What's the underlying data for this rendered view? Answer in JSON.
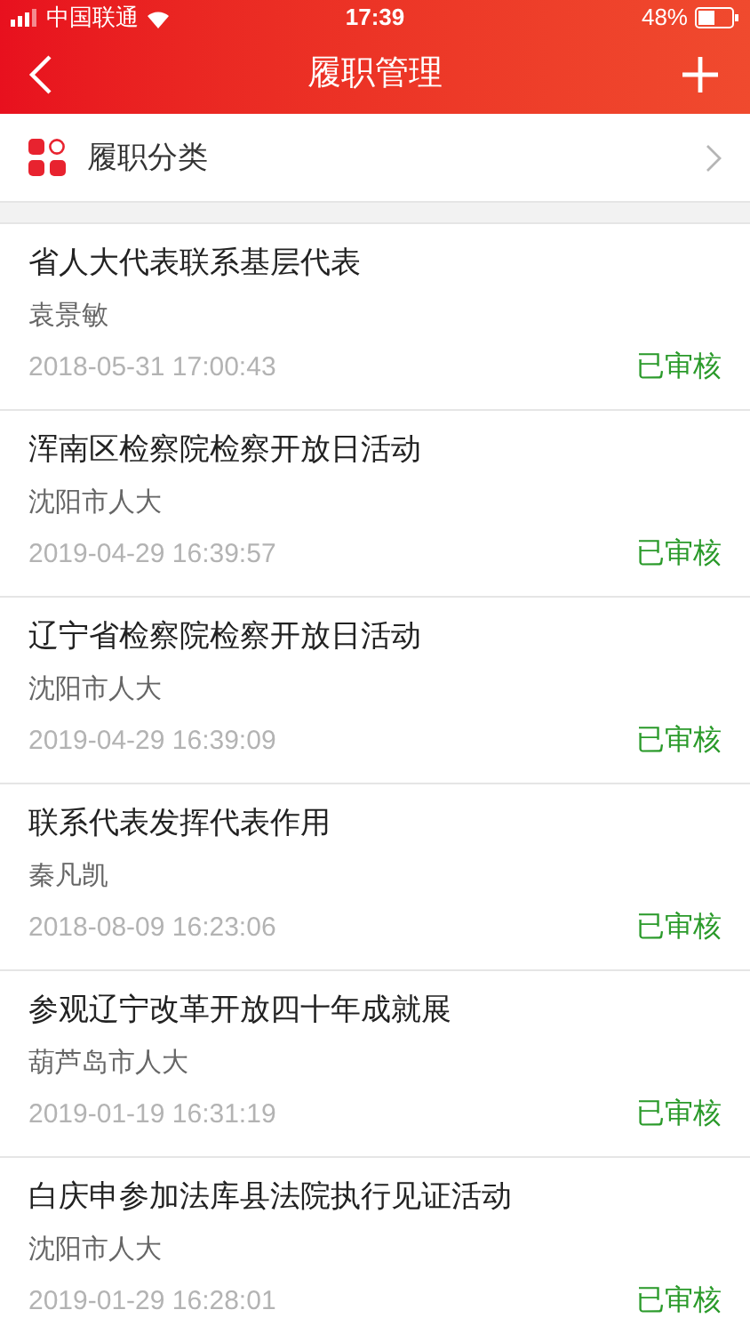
{
  "status_bar": {
    "carrier": "中国联通",
    "time": "17:39",
    "battery": "48%"
  },
  "nav": {
    "title": "履职管理"
  },
  "category": {
    "label": "履职分类"
  },
  "records": [
    {
      "title": "省人大代表联系基层代表",
      "author": "袁景敏",
      "time": "2018-05-31 17:00:43",
      "status": "已审核"
    },
    {
      "title": "浑南区检察院检察开放日活动",
      "author": "沈阳市人大",
      "time": "2019-04-29 16:39:57",
      "status": "已审核"
    },
    {
      "title": "辽宁省检察院检察开放日活动",
      "author": "沈阳市人大",
      "time": "2019-04-29 16:39:09",
      "status": "已审核"
    },
    {
      "title": "联系代表发挥代表作用",
      "author": "秦凡凯",
      "time": "2018-08-09 16:23:06",
      "status": "已审核"
    },
    {
      "title": "参观辽宁改革开放四十年成就展",
      "author": "葫芦岛市人大",
      "time": "2019-01-19 16:31:19",
      "status": "已审核"
    },
    {
      "title": "白庆申参加法库县法院执行见证活动",
      "author": "沈阳市人大",
      "time": "2019-01-29 16:28:01",
      "status": "已审核"
    }
  ]
}
